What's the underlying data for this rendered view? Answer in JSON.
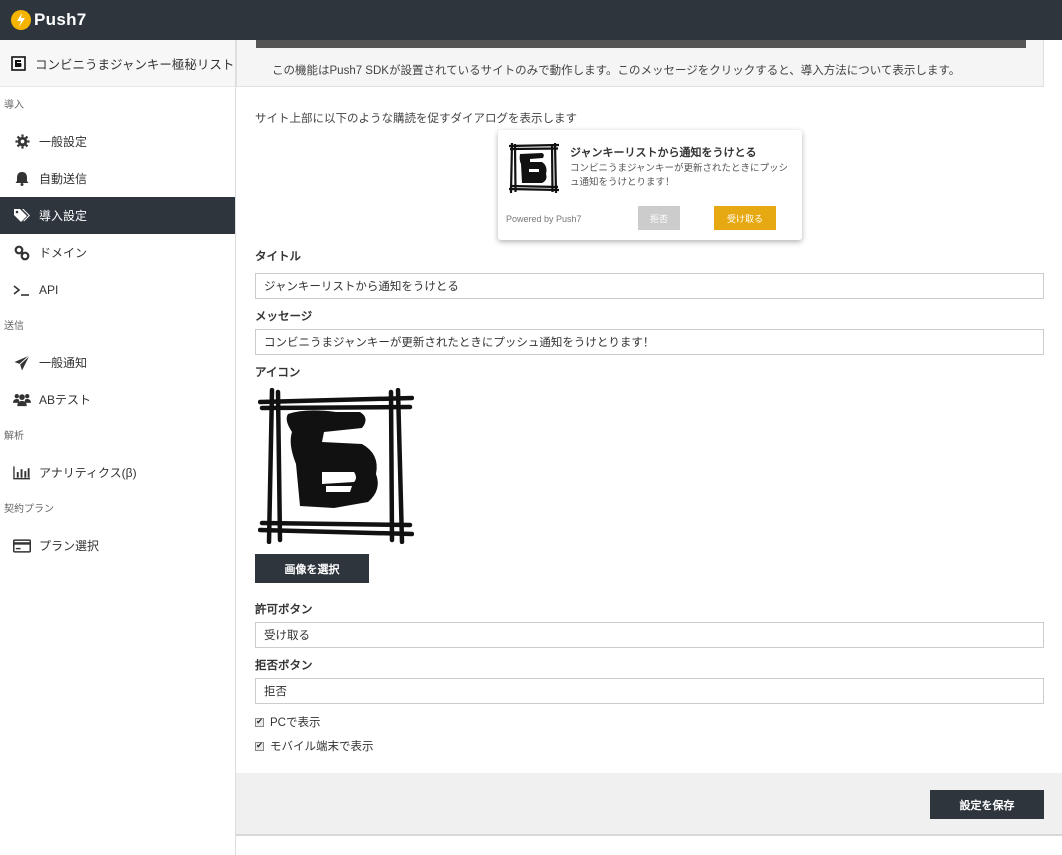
{
  "app": {
    "name": "Push7"
  },
  "sidebar": {
    "site_name": "コンビニうまジャンキー極秘リスト",
    "sections": {
      "intro": "導入",
      "send": "送信",
      "analysis": "解析",
      "plan": "契約プラン"
    },
    "items": {
      "general": "一般設定",
      "auto_send": "自動送信",
      "install": "導入設定",
      "domain": "ドメイン",
      "api": "API",
      "notify": "一般通知",
      "ab_test": "ABテスト",
      "analytics": "アナリティクス(β)",
      "plan_select": "プラン選択"
    }
  },
  "main": {
    "notice": "この機能はPush7 SDKが設置されているサイトのみで動作します。このメッセージをクリックすると、導入方法について表示します。",
    "description": "サイト上部に以下のような購読を促すダイアログを表示します",
    "preview": {
      "title": "ジャンキーリストから通知をうけとる",
      "message": "コンビニうまジャンキーが更新されたときにプッシュ通知をうけとります！",
      "powered": "Powered by Push7",
      "deny": "拒否",
      "accept": "受け取る"
    },
    "title_label": "タイトル",
    "title_value": "ジャンキーリストから通知をうけとる",
    "message_label": "メッセージ",
    "message_value": "コンビニうまジャンキーが更新されたときにプッシュ通知をうけとります！",
    "icon_label": "アイコン",
    "select_image": "画像を選択",
    "allow_label": "許可ボタン",
    "allow_value": "受け取る",
    "deny_label": "拒否ボタン",
    "deny_value": "拒否",
    "show_pc": "PCで表示",
    "show_mobile": "モバイル端末で表示",
    "save": "設定を保存"
  },
  "colors": {
    "dark": "#2e353d",
    "accent": "#e7a912",
    "logo": "#f4b400"
  }
}
